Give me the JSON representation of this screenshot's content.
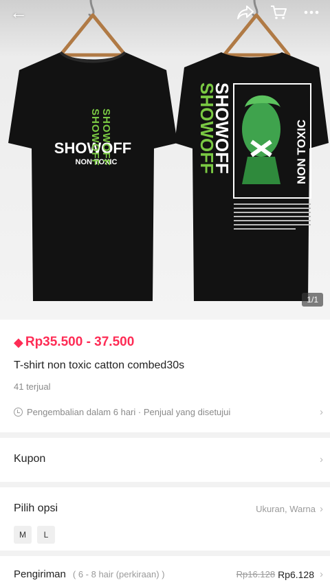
{
  "header": {
    "back_icon": "arrow-left-icon",
    "share_icon": "share-icon",
    "cart_icon": "cart-icon",
    "more_icon": "more-dots-icon"
  },
  "gallery": {
    "counter": "1/1",
    "front_print": {
      "brand": "SHOWOFF",
      "subtitle": "NON TOXIC",
      "vertical_text": "SHOWOFF"
    },
    "back_print": {
      "vertical_text": "SHOWOFF",
      "side_text": "NON TOXIC"
    }
  },
  "product": {
    "price": "Rp35.500 - 37.500",
    "title": "T-shirt non toxic catton combed30s",
    "sold": "41 terjual",
    "returns": "Pengembalian dalam 6 hari · Penjual yang disetujui"
  },
  "coupon": {
    "label": "Kupon"
  },
  "options": {
    "label": "Pilih opsi",
    "value": "Ukuran, Warna",
    "sizes": [
      "M",
      "L"
    ]
  },
  "shipping": {
    "label": "Pengiriman",
    "eta": "( 6 - 8 hair (perkiraan) )",
    "old_price": "Rp16.128",
    "new_price": "Rp6.128"
  },
  "colors": {
    "accent": "#fe2c55",
    "shirt": "#121212",
    "print_green": "#7ac943"
  }
}
